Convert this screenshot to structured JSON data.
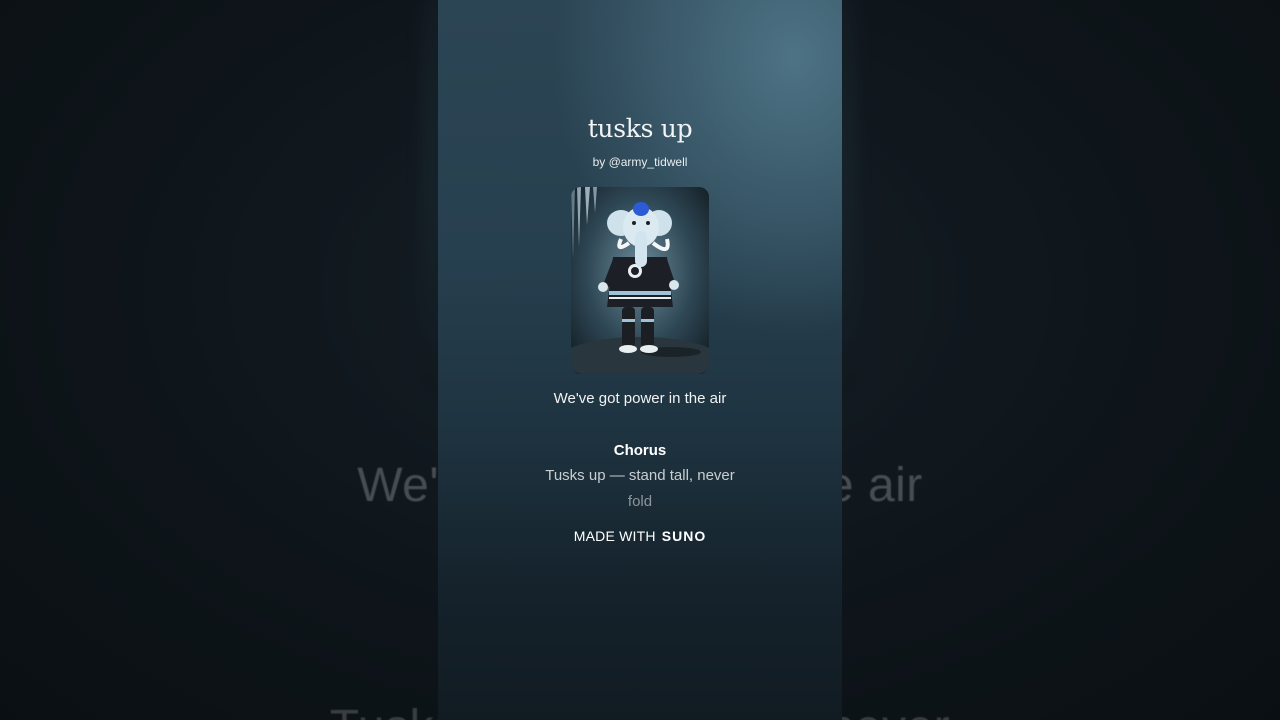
{
  "song": {
    "title": "tusks up",
    "byline": "by @army_tidwell",
    "cover_icon": "mammoth-mascot-cover-art"
  },
  "lyrics": {
    "current_line": "We've got power in the air",
    "section_heading": "Chorus",
    "next_line": "Tusks up — stand tall, never",
    "next_line_continued": "fold"
  },
  "background": {
    "large_lyric_1": "We've got power in the air",
    "large_lyric_2": "Tusks up — stand tall, never"
  },
  "branding": {
    "made_with": "MADE WITH",
    "brand": "SUNO"
  },
  "colors": {
    "card_top": "#2c4554",
    "card_bottom": "#111b22",
    "backdrop": "#12181d"
  }
}
